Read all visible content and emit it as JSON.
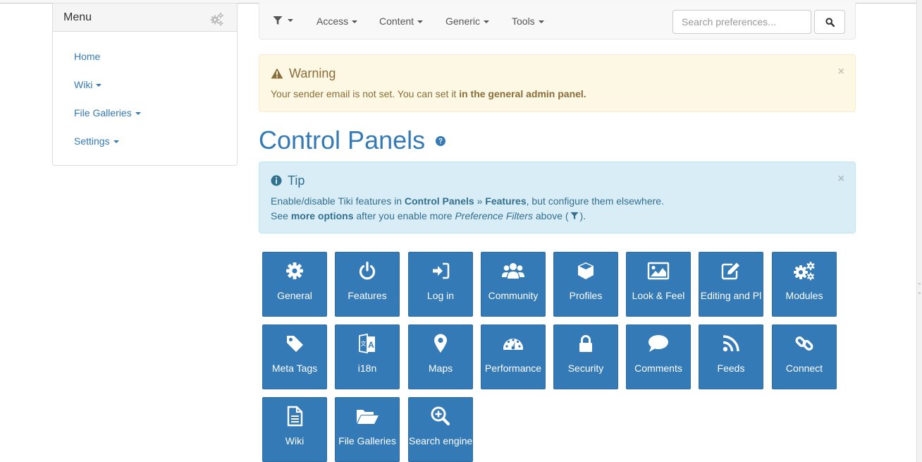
{
  "sidebar": {
    "title": "Menu",
    "items": [
      {
        "label": "Home",
        "dropdown": false
      },
      {
        "label": "Wiki",
        "dropdown": true
      },
      {
        "label": "File Galleries",
        "dropdown": true
      },
      {
        "label": "Settings",
        "dropdown": true
      }
    ]
  },
  "navbar": {
    "items": [
      {
        "label": "Access"
      },
      {
        "label": "Content"
      },
      {
        "label": "Generic"
      },
      {
        "label": "Tools"
      }
    ],
    "search_placeholder": "Search preferences..."
  },
  "warning": {
    "title": "Warning",
    "text": "Your sender email is not set. You can set it ",
    "link": "in the general admin panel."
  },
  "page_title": "Control Panels",
  "tip": {
    "title": "Tip",
    "line1_a": "Enable/disable Tiki features in ",
    "line1_b": "Control Panels",
    "line1_c": " » ",
    "line1_d": "Features",
    "line1_e": ", but configure them elsewhere.",
    "line2_a": "See ",
    "line2_b": "more options",
    "line2_c": " after you enable more ",
    "line2_d": "Preference Filters",
    "line2_e": " above (",
    "line2_f": ")."
  },
  "tiles": [
    {
      "label": "General",
      "icon": "cog-icon"
    },
    {
      "label": "Features",
      "icon": "power-icon"
    },
    {
      "label": "Log in",
      "icon": "sign-in-icon"
    },
    {
      "label": "Community",
      "icon": "users-icon"
    },
    {
      "label": "Profiles",
      "icon": "cube-icon"
    },
    {
      "label": "Look & Feel",
      "icon": "image-icon"
    },
    {
      "label": "Editing and Pl",
      "icon": "edit-icon"
    },
    {
      "label": "Modules",
      "icon": "cogs-icon"
    },
    {
      "label": "Meta Tags",
      "icon": "tag-icon"
    },
    {
      "label": "i18n",
      "icon": "language-icon"
    },
    {
      "label": "Maps",
      "icon": "map-marker-icon"
    },
    {
      "label": "Performance",
      "icon": "dashboard-icon"
    },
    {
      "label": "Security",
      "icon": "lock-icon"
    },
    {
      "label": "Comments",
      "icon": "comment-icon"
    },
    {
      "label": "Feeds",
      "icon": "rss-icon"
    },
    {
      "label": "Connect",
      "icon": "link-icon"
    },
    {
      "label": "Wiki",
      "icon": "file-text-icon"
    },
    {
      "label": "File Galleries",
      "icon": "folder-open-icon"
    },
    {
      "label": "Search engine",
      "icon": "search-plus-icon"
    }
  ],
  "colors": {
    "primary": "#337ab7",
    "warning_bg": "#fcf8e3",
    "info_bg": "#d9edf7"
  }
}
